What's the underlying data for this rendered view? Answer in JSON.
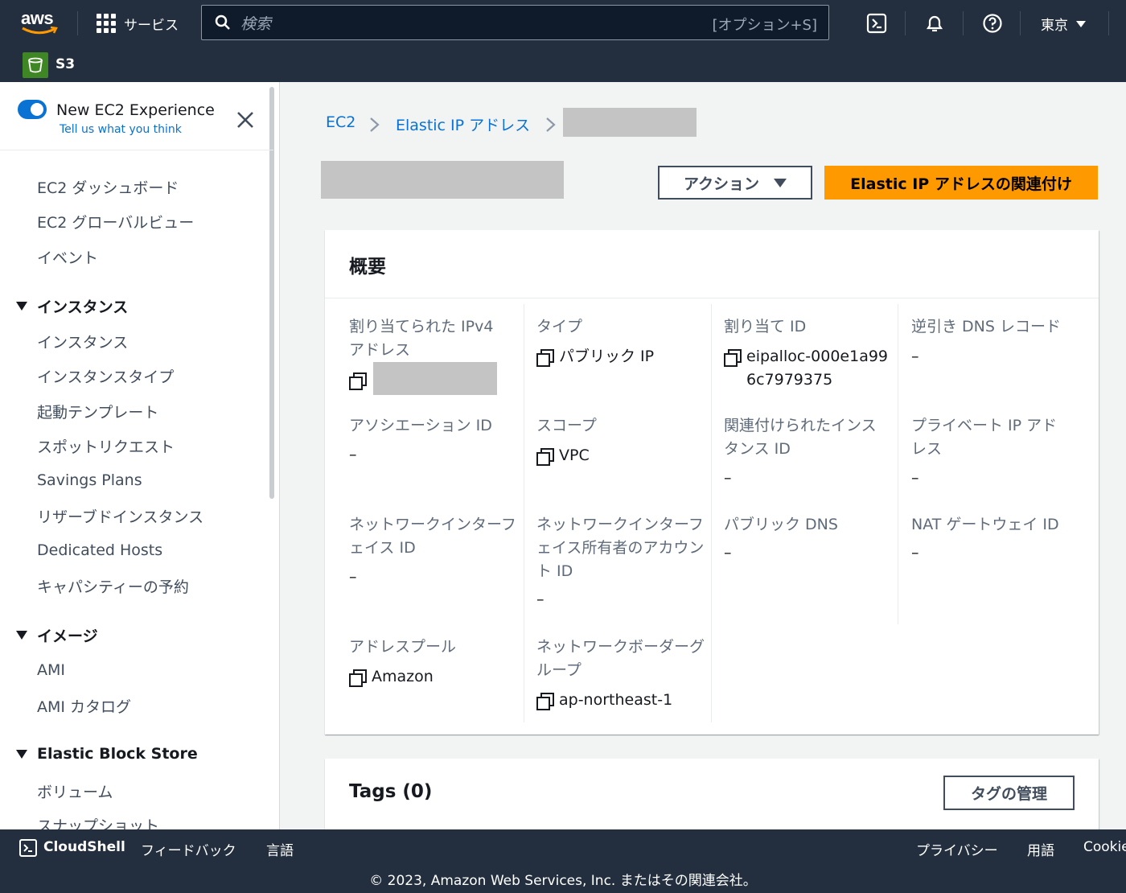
{
  "nav": {
    "logo": "aws",
    "services_label": "サービス",
    "search_placeholder": "検索",
    "search_shortcut": "[オプション+S]",
    "region": "東京",
    "favorite_service": "S3"
  },
  "sidebar": {
    "experience_title": "New EC2 Experience",
    "experience_link": "Tell us what you think",
    "toggle_on": true,
    "top_items": [
      "EC2 ダッシュボード",
      "EC2 グローバルビュー",
      "イベント"
    ],
    "sections": [
      {
        "title": "インスタンス",
        "items": [
          "インスタンス",
          "インスタンスタイプ",
          "起動テンプレート",
          "スポットリクエスト",
          "Savings Plans",
          "リザーブドインスタンス",
          "Dedicated Hosts",
          "キャパシティーの予約"
        ]
      },
      {
        "title": "イメージ",
        "items": [
          "AMI",
          "AMI カタログ"
        ]
      },
      {
        "title": "Elastic Block Store",
        "items": [
          "ボリューム",
          "スナップショット"
        ]
      }
    ]
  },
  "breadcrumb": [
    "EC2",
    "Elastic IP アドレス"
  ],
  "actions_label": "アクション",
  "associate_label": "Elastic IP アドレスの関連付け",
  "summary": {
    "title": "概要",
    "fields": {
      "ipv4_label": "割り当てられた IPv4 アドレス",
      "type_label": "タイプ",
      "type_value": "パブリック IP",
      "alloc_label": "割り当て ID",
      "alloc_value": "eipalloc-000e1a996c7979375",
      "rdns_label": "逆引き DNS レコード",
      "rdns_value": "–",
      "assoc_label": "アソシエーション ID",
      "assoc_value": "–",
      "scope_label": "スコープ",
      "scope_value": "VPC",
      "instance_label": "関連付けられたインスタンス ID",
      "instance_value": "–",
      "private_ip_label": "プライベート IP アドレス",
      "private_ip_value": "–",
      "eni_label": "ネットワークインターフェイス ID",
      "eni_value": "–",
      "eni_owner_label": "ネットワークインターフェイス所有者のアカウント ID",
      "eni_owner_value": "–",
      "public_dns_label": "パブリック DNS",
      "public_dns_value": "–",
      "nat_label": "NAT ゲートウェイ ID",
      "nat_value": "–",
      "pool_label": "アドレスプール",
      "pool_value": "Amazon",
      "border_label": "ネットワークボーダーグループ",
      "border_value": "ap-northeast-1"
    }
  },
  "tags": {
    "title": "Tags (0)",
    "manage_label": "タグの管理"
  },
  "footer": {
    "cloudshell": "CloudShell",
    "feedback": "フィードバック",
    "language": "言語",
    "privacy": "プライバシー",
    "terms": "用語",
    "cookie": "Cookie",
    "copyright": "© 2023, Amazon Web Services, Inc. またはその関連会社。"
  },
  "colors": {
    "nav_bg": "#232f3e",
    "primary_orange": "#ff9900",
    "link_blue": "#0972d3"
  }
}
